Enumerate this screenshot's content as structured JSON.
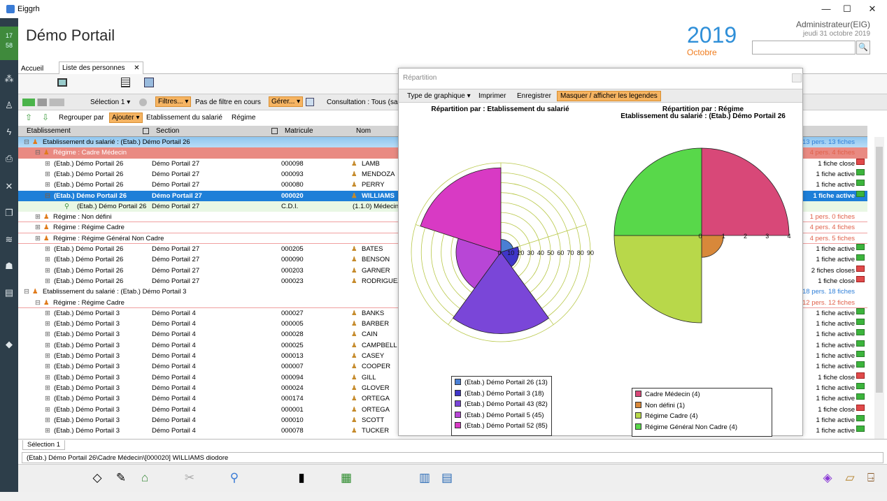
{
  "window": {
    "app_name": "Eiggrh",
    "minimize": "—",
    "maximize": "☐",
    "close": "✕"
  },
  "clock": {
    "hour": "17",
    "minute": "58"
  },
  "header": {
    "title": "Démo Portail",
    "year": "2019",
    "month": "Octobre",
    "user": "Administrateur(EIG)",
    "date": "jeudi 31 octobre 2019",
    "search_value": ""
  },
  "tabs": [
    {
      "label": "Accueil"
    },
    {
      "label": "Liste des personnes",
      "close": "✕"
    }
  ],
  "toolbar": {
    "selection": "Sélection 1",
    "filters": "Filtres...",
    "no_filter": "Pas de filtre en cours",
    "manage": "Gérer...",
    "consultation": "Consultation : Tous (sa",
    "group_by": "Regrouper par",
    "add": "Ajouter",
    "group1": "Etablissement du salarié",
    "group2": "Régime"
  },
  "columns": {
    "etablissement": "Etablissement",
    "section": "Section",
    "matricule": "Matricule",
    "nom": "Nom"
  },
  "rows": [
    {
      "type": "g1",
      "text": "Etablissement du salarié : (Etab.) Démo Portail 26",
      "right": "13 pers. 13 fiches"
    },
    {
      "type": "g2",
      "text": "Régime : Cadre Médecin",
      "right": "4 pers. 4 fiches"
    },
    {
      "type": "p",
      "etab": "(Etab.) Démo Portail 26",
      "section": "Démo Portail 27",
      "mat": "000098",
      "nom": "LAMB",
      "right": "1 fiche close"
    },
    {
      "type": "p",
      "etab": "(Etab.) Démo Portail 26",
      "section": "Démo Portail 27",
      "mat": "000093",
      "nom": "MENDOZA",
      "right": "1 fiche active"
    },
    {
      "type": "p",
      "etab": "(Etab.) Démo Portail 26",
      "section": "Démo Portail 27",
      "mat": "000080",
      "nom": "PERRY",
      "right": "1 fiche active"
    },
    {
      "type": "sel",
      "etab": "(Etab.) Démo Portail 26",
      "section": "Démo Portail 27",
      "mat": "000020",
      "nom": "WILLIAMS",
      "right": "1 fiche active"
    },
    {
      "type": "sub",
      "etab": "(Etab.) Démo Portail 26",
      "section": "Démo Portail 27",
      "mat": "C.D.I.",
      "nom": "(1.1.0) Médecin",
      "right": ""
    },
    {
      "type": "g3",
      "text": "Régime : Non défini",
      "right": "1 pers. 0 fiches"
    },
    {
      "type": "g3",
      "text": "Régime : Régime Cadre",
      "right": "4 pers. 4 fiches"
    },
    {
      "type": "g3",
      "text": "Régime : Régime Général Non Cadre",
      "right": "4 pers. 5 fiches"
    },
    {
      "type": "p",
      "etab": "(Etab.) Démo Portail 26",
      "section": "Démo Portail 27",
      "mat": "000205",
      "nom": "BATES",
      "right": "1 fiche active"
    },
    {
      "type": "p",
      "etab": "(Etab.) Démo Portail 26",
      "section": "Démo Portail 27",
      "mat": "000090",
      "nom": "BENSON",
      "right": "1 fiche active"
    },
    {
      "type": "p",
      "etab": "(Etab.) Démo Portail 26",
      "section": "Démo Portail 27",
      "mat": "000203",
      "nom": "GARNER",
      "right": "2 fiches closes"
    },
    {
      "type": "p",
      "etab": "(Etab.) Démo Portail 26",
      "section": "Démo Portail 27",
      "mat": "000023",
      "nom": "RODRIGUEZ",
      "right": "1 fiche close"
    },
    {
      "type": "g1b",
      "text": "Etablissement du salarié : (Etab.) Démo Portail 3",
      "right": "18 pers. 18 fiches"
    },
    {
      "type": "g3b",
      "text": "Régime : Régime Cadre",
      "right": "12 pers. 12 fiches"
    },
    {
      "type": "p",
      "etab": "(Etab.) Démo Portail 3",
      "section": "Démo Portail 4",
      "mat": "000027",
      "nom": "BANKS",
      "right": "1 fiche active"
    },
    {
      "type": "p",
      "etab": "(Etab.) Démo Portail 3",
      "section": "Démo Portail 4",
      "mat": "000005",
      "nom": "BARBER",
      "right": "1 fiche active"
    },
    {
      "type": "p",
      "etab": "(Etab.) Démo Portail 3",
      "section": "Démo Portail 4",
      "mat": "000028",
      "nom": "CAIN",
      "right": "1 fiche active"
    },
    {
      "type": "p",
      "etab": "(Etab.) Démo Portail 3",
      "section": "Démo Portail 4",
      "mat": "000025",
      "nom": "CAMPBELL",
      "right": "1 fiche active"
    },
    {
      "type": "p",
      "etab": "(Etab.) Démo Portail 3",
      "section": "Démo Portail 4",
      "mat": "000013",
      "nom": "CASEY",
      "right": "1 fiche active"
    },
    {
      "type": "p",
      "etab": "(Etab.) Démo Portail 3",
      "section": "Démo Portail 4",
      "mat": "000007",
      "nom": "COOPER",
      "right": "1 fiche active"
    },
    {
      "type": "p",
      "etab": "(Etab.) Démo Portail 3",
      "section": "Démo Portail 4",
      "mat": "000094",
      "nom": "GILL",
      "right": "1 fiche close"
    },
    {
      "type": "p",
      "etab": "(Etab.) Démo Portail 3",
      "section": "Démo Portail 4",
      "mat": "000024",
      "nom": "GLOVER",
      "right": "1 fiche active"
    },
    {
      "type": "p",
      "etab": "(Etab.) Démo Portail 3",
      "section": "Démo Portail 4",
      "mat": "000174",
      "nom": "ORTEGA",
      "right": "1 fiche active"
    },
    {
      "type": "p",
      "etab": "(Etab.) Démo Portail 3",
      "section": "Démo Portail 4",
      "mat": "000001",
      "nom": "ORTEGA",
      "right": "1 fiche close"
    },
    {
      "type": "p",
      "etab": "(Etab.) Démo Portail 3",
      "section": "Démo Portail 4",
      "mat": "000010",
      "nom": "SCOTT",
      "right": "1 fiche active"
    },
    {
      "type": "p",
      "etab": "(Etab.) Démo Portail 3",
      "section": "Démo Portail 4",
      "mat": "000078",
      "nom": "TUCKER",
      "right": "1 fiche active"
    }
  ],
  "selection_tab": "Sélection 1",
  "path": "(Etab.) Démo Portail 26\\Cadre Médecin\\[000020] WILLIAMS diodore",
  "popup": {
    "title": "Répartition",
    "menu": {
      "chart_type": "Type de graphique",
      "print": "Imprimer",
      "save": "Enregistrer",
      "toggle_legend": "Masquer / afficher les legendes"
    }
  },
  "colors": {
    "accent_blue": "#2f8fd8",
    "orange": "#f07c1d",
    "selection": "#1e7fd8",
    "active": "#3cb43c",
    "closed": "#e04a4a"
  },
  "chart_data": [
    {
      "type": "polar-area",
      "title": "Répartition par : Etablissement du salarié",
      "radial_ticks": [
        "0",
        "10",
        "20",
        "30",
        "40",
        "50",
        "60",
        "70",
        "80",
        "90"
      ],
      "rmax": 90,
      "categories": [
        "(Etab.) Démo Portail 26",
        "(Etab.) Démo Portail 3",
        "(Etab.) Démo Portail 43",
        "(Etab.) Démo Portail 5",
        "(Etab.) Démo Portail 52"
      ],
      "values": [
        13,
        18,
        82,
        45,
        85
      ],
      "legend_labels": [
        "(Etab.) Démo Portail 26 (13)",
        "(Etab.) Démo Portail 3 (18)",
        "(Etab.) Démo Portail 43 (82)",
        "(Etab.) Démo Portail 5 (45)",
        "(Etab.) Démo Portail 52 (85)"
      ],
      "colors": [
        "#4a7fd4",
        "#3f35c8",
        "#7a46d8",
        "#b846d6",
        "#d83ac4"
      ],
      "grid": true,
      "legend": "bottom"
    },
    {
      "type": "polar-area",
      "title": "Répartition par : Régime",
      "subtitle": "Etablissement du salarié : (Etab.) Démo Portail 26",
      "radial_ticks": [
        "0",
        "1",
        "2",
        "3",
        "4"
      ],
      "rmax": 4,
      "categories": [
        "Cadre Médecin",
        "Non défini",
        "Régime Cadre",
        "Régime Général Non Cadre"
      ],
      "values": [
        4,
        1,
        4,
        4
      ],
      "legend_labels": [
        "Cadre Médecin (4)",
        "Non défini (1)",
        "Régime Cadre (4)",
        "Régime Général Non Cadre (4)"
      ],
      "colors": [
        "#d84878",
        "#d8883a",
        "#b8d84a",
        "#58d84a"
      ],
      "grid": false,
      "legend": "bottom"
    }
  ]
}
